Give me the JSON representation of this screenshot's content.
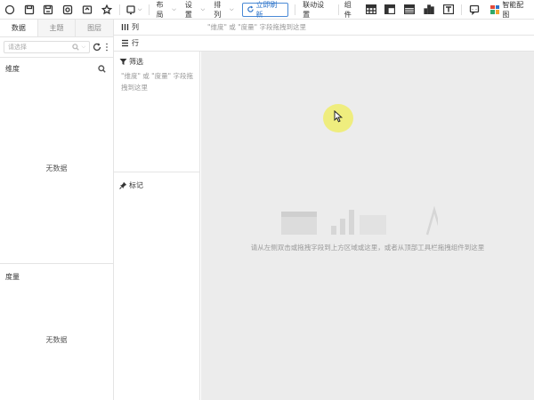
{
  "toolbar": {
    "layout_label": "布局",
    "settings_label": "设置",
    "arrange_label": "排列",
    "refresh_label": "立即刷新",
    "linkage_label": "联动设置",
    "component_label": "组件",
    "smart_label": "智能配图"
  },
  "left_panel": {
    "tabs": [
      "数据",
      "主题",
      "图层"
    ],
    "select_placeholder": "请选择",
    "dimension_title": "维度",
    "dimension_empty": "无数据",
    "measure_title": "度量",
    "measure_empty": "无数据"
  },
  "shelves": {
    "column_label": "列",
    "row_label": "行",
    "column_hint": "\"维度\" 或 \"度量\" 字段拖拽到这里"
  },
  "middle_panel": {
    "filter_title": "筛选",
    "filter_hint": "\"维度\" 或 \"度量\" 字段拖拽到这里",
    "mark_title": "标记"
  },
  "canvas": {
    "hint": "请从左侧双击或拖拽字段到上方区域或这里，或者从顶部工具栏拖拽组件到这里"
  },
  "colors": {
    "accent": "#2f74c9",
    "canvas_bg": "#ececec",
    "cursor_highlight": "#f0ee5a"
  }
}
